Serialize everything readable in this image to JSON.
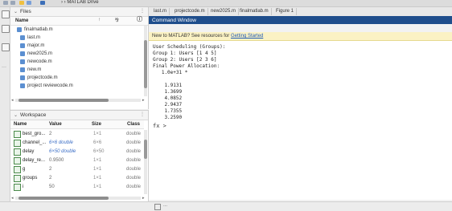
{
  "toolbar": {
    "path": "›  ›  MATLAB Drive"
  },
  "files": {
    "title": "Files",
    "column_name": "Name",
    "items": [
      "finalmatlab.m",
      "last.m",
      "major.m",
      "new2025.m",
      "newcode.m",
      "new.m",
      "projectcode.m",
      "project reviewcode.m"
    ]
  },
  "workspace": {
    "title": "Workspace",
    "columns": [
      "Name",
      "Value",
      "Size",
      "Class"
    ],
    "rows": [
      {
        "name": "best_gro...",
        "value": "2",
        "size": "1×1",
        "class": "double"
      },
      {
        "name": "channel_...",
        "value": "6×6 double",
        "size": "6×6",
        "class": "double"
      },
      {
        "name": "delay",
        "value": "6×50 double",
        "size": "6×50",
        "class": "double"
      },
      {
        "name": "delay_re...",
        "value": "0.9500",
        "size": "1×1",
        "class": "double"
      },
      {
        "name": "g",
        "value": "2",
        "size": "1×1",
        "class": "double"
      },
      {
        "name": "groups",
        "value": "2",
        "size": "1×1",
        "class": "double"
      },
      {
        "name": "i",
        "value": "50",
        "size": "1×1",
        "class": "double"
      }
    ]
  },
  "editor": {
    "tabs": [
      "last.m",
      "projectcode.m",
      "new2025.m",
      "finalmatlab.m",
      "Figure 1"
    ]
  },
  "command_window": {
    "title": "Command Window",
    "banner_text": "New to MATLAB? See resources for ",
    "banner_link": "Getting Started",
    "lines": [
      "User Scheduling (Groups):",
      "Group 1: Users [1 4 5]",
      "Group 2: Users [2 3 6]",
      "Final Power Allocation:",
      "   1.0e+31 *",
      "",
      "    1.9131",
      "    1.3699",
      "    4.0852",
      "    2.9437",
      "    1.7355",
      "    3.2590"
    ],
    "prompt": "fx >"
  },
  "statusbar": {
    "more": "..."
  },
  "colors": {
    "accent": "#1f4e8c",
    "banner": "#fbf2c4",
    "link": "#1c58b5"
  }
}
